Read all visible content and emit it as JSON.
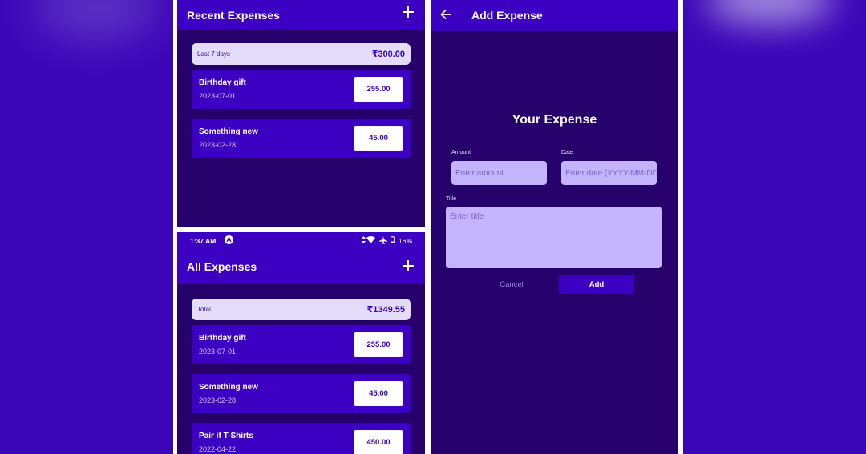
{
  "colors": {
    "background": "#3a06b8",
    "appbar": "#3c00c2",
    "screen": "#26006b",
    "card": "#3c00c2",
    "summary": "#e3ddfa",
    "input": "#c4b4fb"
  },
  "recent": {
    "title": "Recent Expenses",
    "add_icon": "plus-icon",
    "summary_label": "Last 7 days",
    "summary_amount": "₹300.00",
    "items": [
      {
        "name": "Birthday gift",
        "date": "2023-07-01",
        "amount": "255.00"
      },
      {
        "name": "Something new",
        "date": "2023-02-28",
        "amount": "45.00"
      }
    ]
  },
  "all": {
    "status": {
      "time": "1:37 AM",
      "battery": "16%"
    },
    "title": "All Expenses",
    "add_icon": "plus-icon",
    "summary_label": "Total",
    "summary_amount": "₹1349.55",
    "items": [
      {
        "name": "Birthday gift",
        "date": "2023-07-01",
        "amount": "255.00"
      },
      {
        "name": "Something new",
        "date": "2023-02-28",
        "amount": "45.00"
      },
      {
        "name": "Pair if T-Shirts",
        "date": "2022-04-22",
        "amount": "450.00"
      }
    ]
  },
  "add": {
    "title": "Add Expense",
    "back_icon": "arrow-left-icon",
    "heading": "Your Expense",
    "amount_label": "Amount",
    "amount_placeholder": "Enter amount",
    "date_label": "Date",
    "date_placeholder": "Enter date (YYYY-MM-DD)",
    "title_label": "Title",
    "title_placeholder": "Enter title",
    "cancel_label": "Cancel",
    "add_label": "Add"
  }
}
